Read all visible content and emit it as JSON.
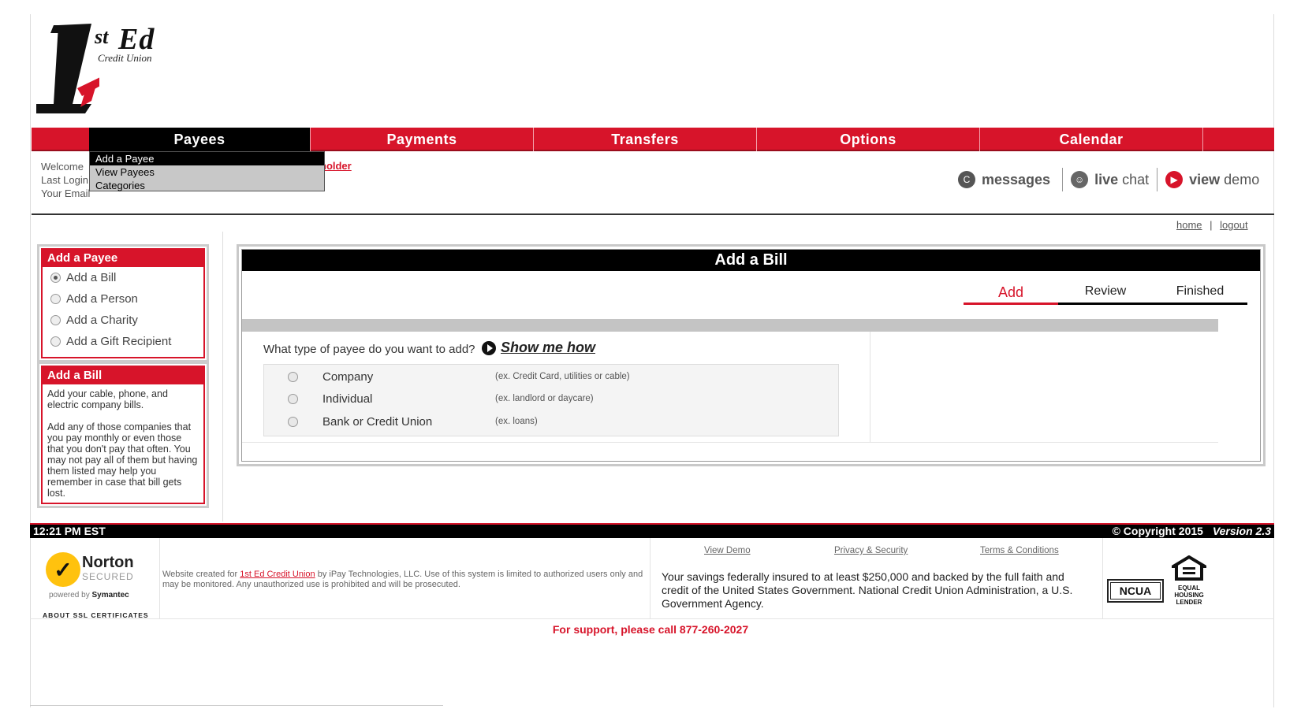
{
  "brand": {
    "logo_st": "st",
    "logo_ed": "Ed",
    "logo_sub": "Credit Union"
  },
  "nav": {
    "items": [
      {
        "label": "Payees"
      },
      {
        "label": "Payments"
      },
      {
        "label": "Transfers"
      },
      {
        "label": "Options"
      },
      {
        "label": "Calendar"
      }
    ],
    "dropdown": [
      {
        "label": "Add a Payee"
      },
      {
        "label": "View Payees"
      },
      {
        "label": "Categories"
      }
    ]
  },
  "welcome": {
    "line1": "Welcome",
    "line2": "Last Login",
    "line3": "Your Email",
    "holder": "holder"
  },
  "utility": {
    "messages": "messages",
    "live_bold": "live",
    "live_rest": "chat",
    "view_bold": "view",
    "view_rest": "demo"
  },
  "toplinks": {
    "home": "home",
    "sep": "|",
    "logout": "logout"
  },
  "sidebar": {
    "add_payee_title": "Add a Payee",
    "options": [
      {
        "label": "Add a Bill",
        "checked": true
      },
      {
        "label": "Add a Person",
        "checked": false
      },
      {
        "label": "Add a Charity",
        "checked": false
      },
      {
        "label": "Add a Gift Recipient",
        "checked": false
      }
    ],
    "add_bill_title": "Add a Bill",
    "add_bill_text1": "Add your cable, phone, and electric company bills.",
    "add_bill_text2": "Add any of those companies that you pay monthly or even those that you don't pay that often. You may not pay all of them but having them listed may help you remember in case that bill gets lost."
  },
  "main": {
    "title": "Add a Bill",
    "steps": [
      "Add",
      "Review",
      "Finished"
    ],
    "active_step": "Add",
    "question": "What type of payee do you want to add?",
    "show_how": "Show me how",
    "payee_types": [
      {
        "label": "Company",
        "example": "(ex. Credit Card, utilities or cable)"
      },
      {
        "label": "Individual",
        "example": "(ex. landlord or daycare)"
      },
      {
        "label": "Bank or Credit Union",
        "example": "(ex. loans)"
      }
    ]
  },
  "footer": {
    "time": "12:21 PM EST",
    "copyright": "© Copyright 2015",
    "version": "Version 2.3",
    "norton_name": "Norton",
    "norton_secured": "SECURED",
    "norton_powered": "powered by",
    "norton_symantec": "Symantec",
    "ssl": "ABOUT SSL CERTIFICATES",
    "created_prefix": "Website created for",
    "created_link": "1st Ed Credit Union",
    "created_suffix": "by iPay Technologies, LLC. Use of this system is limited to authorized users only and may be monitored. Any unauthorized use is prohibited and will be prosecuted.",
    "links": [
      "View Demo",
      "Privacy & Security",
      "Terms & Conditions"
    ],
    "insured": "Your savings federally insured to at least $250,000 and backed by the full faith and credit of the United States Government. National Credit Union Administration, a U.S. Government Agency.",
    "ncua": "NCUA",
    "ehl": "EQUAL HOUSING LENDER",
    "support": "For support, please call 877-260-2027"
  },
  "colors": {
    "brand_red": "#d7142a",
    "black": "#000000"
  }
}
